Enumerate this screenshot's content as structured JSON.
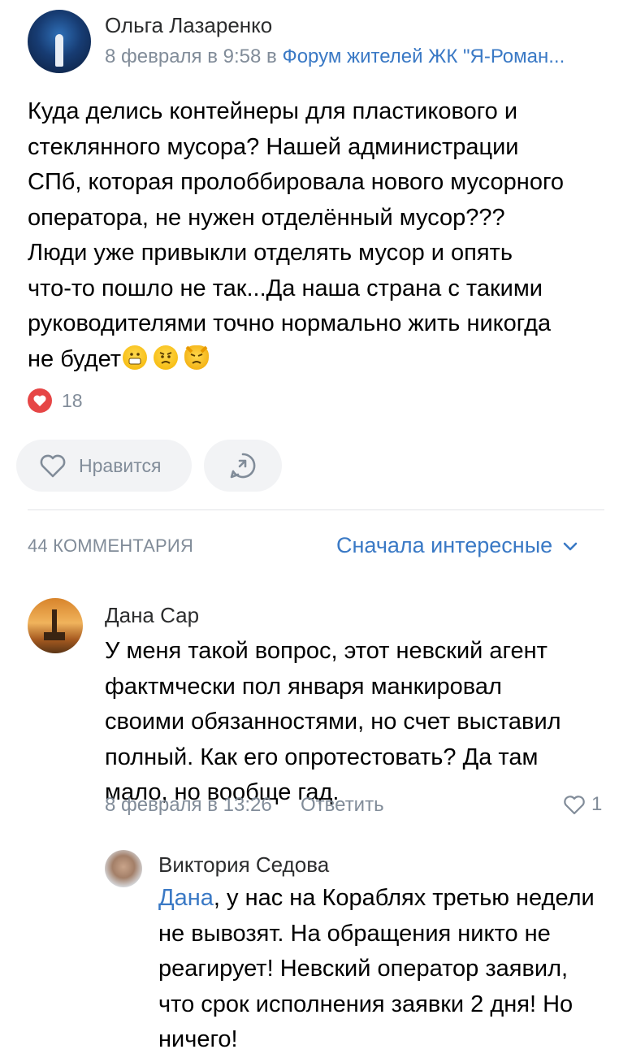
{
  "post": {
    "author": "Ольга Лазаренко",
    "date": "8 февраля в 9:58",
    "in_word": "в",
    "group": "Форум жителей ЖК \"Я-Роман...",
    "text_lines": [
      "Куда делись контейнеры для пластикового и",
      "стеклянного мусора? Нашей администрации",
      "СПб, которая пролоббировала  нового мусорного",
      "оператора, не нужен отделённый мусор???",
      "Люди уже привыкли отделять мусор и опять",
      "что-то пошло не так...Да наша страна с такими",
      "руководителями точно нормально жить никогда",
      "не будет"
    ],
    "emojis": [
      "grimacing-face-emoji",
      "angry-face-emoji",
      "pouting-cat-emoji"
    ],
    "reactions_count": "18",
    "like_label": "Нравится"
  },
  "comments_header": {
    "count_label": "44 КОММЕНТАРИЯ",
    "sort_label": "Сначала интересные"
  },
  "comments": [
    {
      "author": "Дана Сар",
      "text_lines": [
        "У меня такой вопрос, этот невский агент",
        "фактмчески пол января манкировал",
        "своими обязанностями, но счет выставил",
        "полный. Как его опротестовать? Да там",
        "мало, но вообще гад."
      ],
      "date": "8 февраля в 13:26",
      "reply_label": "Ответить",
      "likes": "1"
    }
  ],
  "reply": {
    "author": "Виктория Седова",
    "mention": "Дана",
    "first_line_rest": ", у нас на Кораблях третью недели",
    "text_lines": [
      "не вывозят. На обращения никто не",
      "реагирует! Невский оператор заявил,",
      "что срок исполнения заявки 2 дня! Но",
      "ничего!"
    ]
  },
  "colors": {
    "link": "#3a79c5",
    "meta": "#818c99",
    "reaction_red": "#e64646",
    "pill_bg": "#f2f3f5"
  }
}
